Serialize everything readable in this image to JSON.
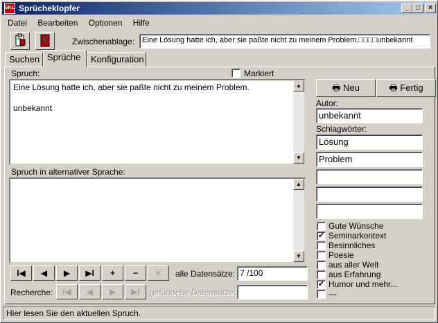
{
  "window": {
    "title": "Sprücheklopfer",
    "icon_text": "SKL"
  },
  "titlebar_buttons": [
    "_",
    "□",
    "×"
  ],
  "menu": [
    "Datei",
    "Bearbeiten",
    "Optionen",
    "Hilfe"
  ],
  "toolbar": {
    "clipboard_label": "Zwischenablage:",
    "clipboard_value": "Eine Lösung hatte ich, aber sie paßte nicht zu meinem Problem.□□□□unbekannt"
  },
  "tabs": [
    "Suchen",
    "Sprüche",
    "Konfiguration"
  ],
  "spruch": {
    "label": "Spruch:",
    "marked_label": "Markiert",
    "text_line1": "Eine Lösung hatte ich, aber sie paßte nicht zu meinem Problem.",
    "text_line2": "unbekannt",
    "alt_label": "Spruch in alternativer Sprache:",
    "alt_text": ""
  },
  "nav": {
    "buttons": [
      "I◀",
      "◀",
      "▶",
      "▶I",
      "+",
      "−",
      "✕"
    ],
    "all_records_label": "alle Datensätze:",
    "all_records_value": "7 /100",
    "search_label": "Recherche:",
    "search_buttons": [
      "I◀",
      "◀",
      "▶",
      "▶I"
    ],
    "found_label": "gefundene Datensätze:",
    "found_value": ""
  },
  "right": {
    "new_button": "Neu",
    "done_button": "Fertig",
    "author_label": "Autor:",
    "author_value": "unbekannt",
    "keywords_label": "Schlagwörter:",
    "keywords": [
      "Lösung",
      "Problem",
      "",
      "",
      ""
    ],
    "categories": [
      {
        "label": "Gute Wünsche",
        "checked": false
      },
      {
        "label": "Seminarkontext",
        "checked": true
      },
      {
        "label": "Besinnliches",
        "checked": false
      },
      {
        "label": "Poesie",
        "checked": false
      },
      {
        "label": "aus aller Welt",
        "checked": false
      },
      {
        "label": "aus Erfahrung",
        "checked": false
      },
      {
        "label": "Humor und mehr...",
        "checked": true
      },
      {
        "label": "---",
        "checked": false
      }
    ]
  },
  "status": "Hier lesen Sie den aktuellen Spruch."
}
